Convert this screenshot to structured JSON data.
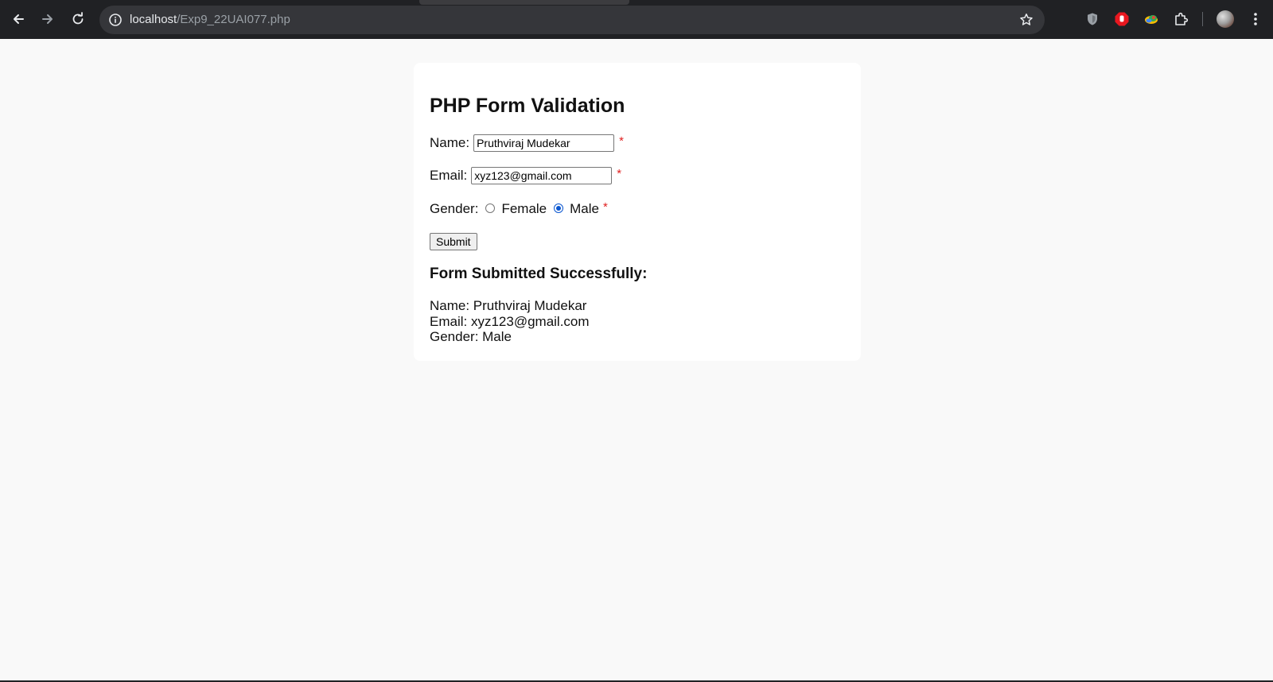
{
  "browser": {
    "url_host": "localhost",
    "url_path": "/Exp9_22UAI077.php",
    "icons": [
      "back-arrow-icon",
      "forward-arrow-icon",
      "reload-icon",
      "site-info-icon",
      "bookmark-star-icon",
      "shield-extension-icon",
      "stop-extension-icon",
      "colorful-extension-icon",
      "extensions-puzzle-icon",
      "profile-avatar",
      "menu-dots-icon"
    ]
  },
  "form": {
    "title": "PHP Form Validation",
    "name_label": "Name:",
    "name_value": "Pruthviraj Mudekar",
    "email_label": "Email:",
    "email_value": "xyz123@gmail.com",
    "gender_label": "Gender:",
    "gender_options": [
      "Female",
      "Male"
    ],
    "gender_selected": "Male",
    "required_mark": "*",
    "submit_label": "Submit"
  },
  "result": {
    "title": "Form Submitted Successfully:",
    "name_line": "Name: Pruthviraj Mudekar",
    "email_line": "Email: xyz123@gmail.com",
    "gender_line": "Gender: Male"
  },
  "colors": {
    "browser_bar": "#202124",
    "page_background": "#f9f9f9",
    "card_background": "#ffffff",
    "required_red": "#e02020",
    "radio_blue": "#0b57d0"
  }
}
